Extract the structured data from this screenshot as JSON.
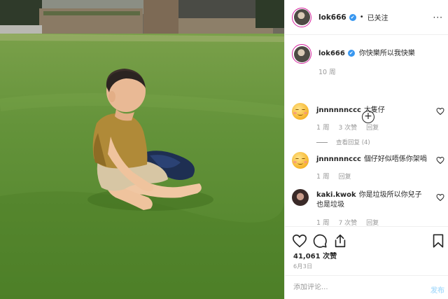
{
  "header": {
    "username": "lok666",
    "verified_mark": "✔",
    "separator": "•",
    "follow_state": "已关注",
    "more_glyph": "···"
  },
  "caption": {
    "username": "lok666",
    "text": "你快樂所以我快樂",
    "time": "10 周"
  },
  "load_more_glyph": "+",
  "comments": [
    {
      "username": "jnnnnnnccc",
      "text": "大隻仔",
      "time": "1 周",
      "likes": "3 次赞",
      "reply": "回复",
      "view_replies": "查看回复 (4)",
      "avatar": "smiling-emoji"
    },
    {
      "username": "jnnnnnnccc",
      "text": "個仔好似唔係你架喎",
      "time": "1 周",
      "reply": "回复",
      "avatar": "smiling-emoji"
    },
    {
      "username": "kaki.kwok",
      "text": "你是垃圾所以你兒子也是垃圾",
      "time": "1 周",
      "likes": "7 次赞",
      "reply": "回复",
      "avatar": "profile-photo"
    }
  ],
  "actions": {
    "icons": [
      "heart-icon",
      "comment-icon",
      "share-icon",
      "bookmark-icon"
    ],
    "likes": "41,061 次赞",
    "date": "6月3日"
  },
  "add_comment": {
    "placeholder": "添加评论...",
    "post_label": "发布"
  },
  "colors": {
    "accent_blue": "#3897f0",
    "post_disabled": "#b2dffc",
    "muted_text": "#999999",
    "grass": "#5f8e35"
  }
}
